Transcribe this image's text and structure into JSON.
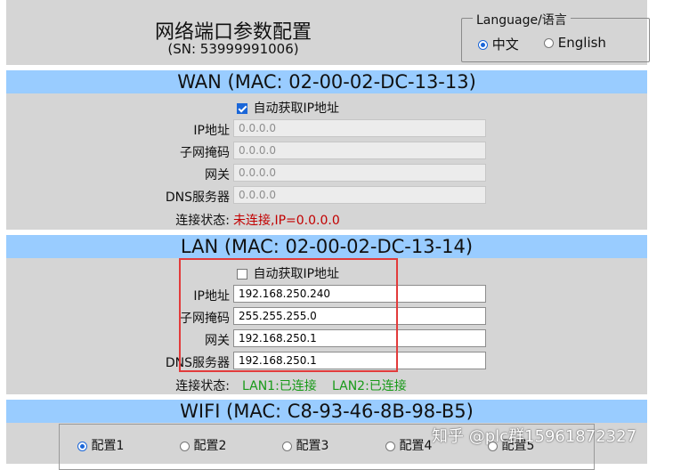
{
  "header": {
    "title": "网络端口参数配置",
    "sn": "(SN: 53999991006)",
    "language": {
      "legend": "Language/语言",
      "options": [
        {
          "label": "中文",
          "selected": true
        },
        {
          "label": "English",
          "selected": false
        }
      ]
    }
  },
  "wan": {
    "title": "WAN (MAC: 02-00-02-DC-13-13)",
    "auto_ip": {
      "label": "自动获取IP地址",
      "checked": true
    },
    "fields": [
      {
        "label": "IP地址",
        "value": "0.0.0.0"
      },
      {
        "label": "子网掩码",
        "value": "0.0.0.0"
      },
      {
        "label": "网关",
        "value": "0.0.0.0"
      },
      {
        "label": "DNS服务器",
        "value": "0.0.0.0"
      }
    ],
    "status_label": "连接状态:",
    "status_value": "未连接,IP=0.0.0.0"
  },
  "lan": {
    "title": "LAN (MAC: 02-00-02-DC-13-14)",
    "auto_ip": {
      "label": "自动获取IP地址",
      "checked": false
    },
    "fields": [
      {
        "label": "IP地址",
        "value": "192.168.250.240"
      },
      {
        "label": "子网掩码",
        "value": "255.255.255.0"
      },
      {
        "label": "网关",
        "value": "192.168.250.1"
      },
      {
        "label": "DNS服务器",
        "value": "192.168.250.1"
      }
    ],
    "status_label": "连接状态:",
    "status_lan1": "LAN1:已连接",
    "status_lan2": "LAN2:已连接"
  },
  "wifi": {
    "title": "WIFI (MAC: C8-93-46-8B-98-B5)",
    "configs": [
      {
        "label": "配置1",
        "selected": true
      },
      {
        "label": "配置2",
        "selected": false
      },
      {
        "label": "配置3",
        "selected": false
      },
      {
        "label": "配置4",
        "selected": false
      },
      {
        "label": "配置5",
        "selected": false
      }
    ]
  },
  "watermark": "知乎 @plc群15961872327",
  "colors": {
    "section_bar": "#99ccff",
    "panel": "#d5d5d5",
    "highlight_box": "#e23b3b",
    "status_error": "#c20000",
    "status_ok": "#189a18"
  }
}
